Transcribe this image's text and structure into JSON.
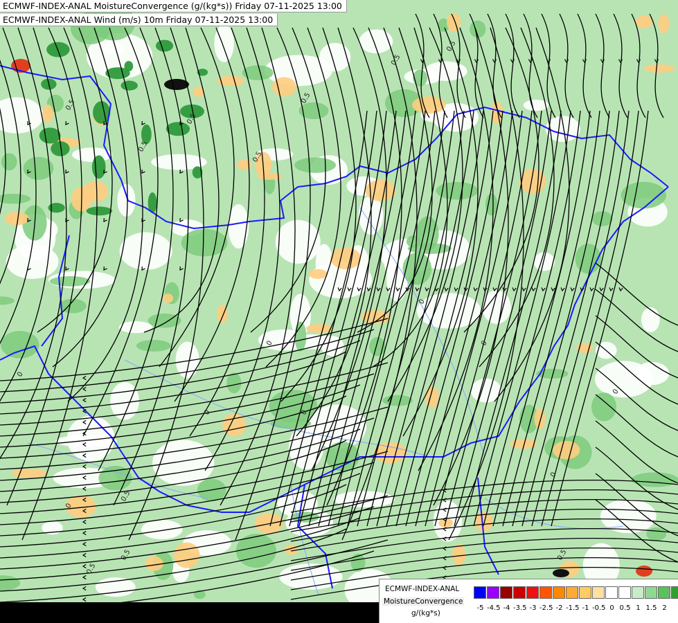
{
  "titles": {
    "line1": "ECMWF-INDEX-ANAL MoistureConvergence (g/(kg*s)) Friday 07-11-2025 13:00",
    "line2": "ECMWF-INDEX-ANAL Wind (m/s) 10m Friday 07-11-2025 13:00"
  },
  "legend": {
    "model": "ECMWF-INDEX-ANAL",
    "parameter": "MoistureConvergence",
    "unit": "g/(kg*s)",
    "colors": [
      "#0000ff",
      "#9900ff",
      "#990000",
      "#cc0000",
      "#ee1111",
      "#ff5500",
      "#ff8800",
      "#ffaa33",
      "#ffcc66",
      "#ffe0a0",
      "#ffffff",
      "#ffffff",
      "#c8ecc8",
      "#90d890",
      "#5cc05c",
      "#30a030",
      "#108010"
    ],
    "ticks": [
      "-5",
      "-4.5",
      "-4",
      "-3.5",
      "-3",
      "-2.5",
      "-2",
      "-1.5",
      "-1",
      "-0.5",
      "0",
      "0.5",
      "1",
      "1.5",
      "2"
    ]
  },
  "contour_labels": [
    "0.5",
    "0.5",
    "0.5",
    "0.5",
    "0.5",
    "0.5",
    "0.5",
    "0",
    "0",
    "0",
    "0",
    "0",
    "0",
    "0.5",
    "0.5",
    "0",
    "0.5",
    "0.5",
    "0",
    "0"
  ],
  "colors": {
    "base_green": "#b8e4b4",
    "mid_green": "#7ccb7c",
    "dark_green": "#2e9a3c",
    "orange": "#ffcc80",
    "red": "#e04020",
    "border_blue": "#1a1aff",
    "river_blue": "#7fa8ff",
    "streamline": "#000000"
  }
}
